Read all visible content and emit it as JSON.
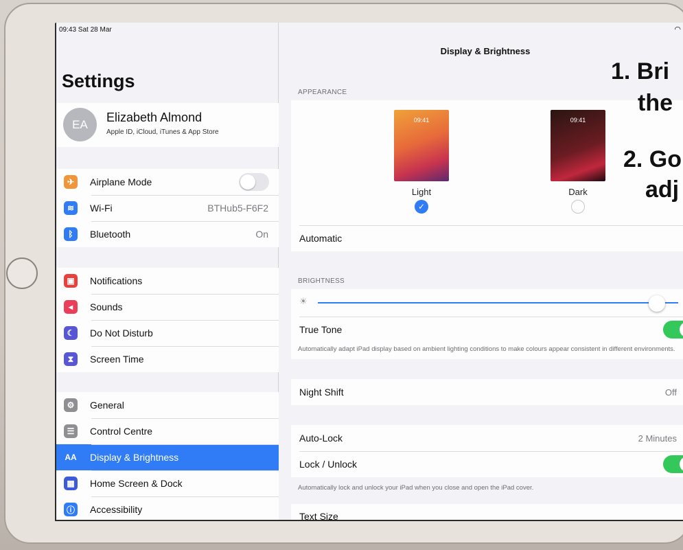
{
  "status": {
    "time": "09:43  Sat 28 Mar",
    "wifi_icon": "wifi-icon"
  },
  "sidebar": {
    "title": "Settings",
    "profile": {
      "initials": "EA",
      "name": "Elizabeth Almond",
      "subtitle": "Apple ID, iCloud, iTunes & App Store"
    },
    "group1": [
      {
        "label": "Airplane Mode",
        "icon": "airplane-icon",
        "color": "#f0953a",
        "glyph": "✈",
        "accessory": "toggle-off"
      },
      {
        "label": "Wi-Fi",
        "icon": "wifi-icon",
        "color": "#2f7cf6",
        "glyph": "≋",
        "value": "BTHub5-F6F2"
      },
      {
        "label": "Bluetooth",
        "icon": "bluetooth-icon",
        "color": "#2f7cf6",
        "glyph": "ᛒ",
        "value": "On"
      }
    ],
    "group2": [
      {
        "label": "Notifications",
        "icon": "notifications-icon",
        "color": "#ea3f3a",
        "glyph": "▣"
      },
      {
        "label": "Sounds",
        "icon": "speaker-icon",
        "color": "#ea3f5a",
        "glyph": "◂"
      },
      {
        "label": "Do Not Disturb",
        "icon": "moon-icon",
        "color": "#5856d6",
        "glyph": "☾"
      },
      {
        "label": "Screen Time",
        "icon": "hourglass-icon",
        "color": "#5856d6",
        "glyph": "⧗"
      }
    ],
    "group3": [
      {
        "label": "General",
        "icon": "gear-icon",
        "color": "#8e8e93",
        "glyph": "⚙"
      },
      {
        "label": "Control Centre",
        "icon": "switches-icon",
        "color": "#8e8e93",
        "glyph": "☰"
      },
      {
        "label": "Display & Brightness",
        "icon": "text-size-icon",
        "color": "#2f7cf6",
        "glyph": "AA",
        "selected": true
      },
      {
        "label": "Home Screen & Dock",
        "icon": "grid-icon",
        "color": "#3d5bd9",
        "glyph": "▦"
      },
      {
        "label": "Accessibility",
        "icon": "accessibility-icon",
        "color": "#2f7cf6",
        "glyph": "ⓘ"
      }
    ]
  },
  "detail": {
    "nav_title": "Display & Brightness",
    "appearance_header": "APPEARANCE",
    "light": {
      "time": "09:41",
      "label": "Light",
      "selected": true
    },
    "dark": {
      "time": "09:41",
      "label": "Dark",
      "selected": false
    },
    "automatic_label": "Automatic",
    "brightness_header": "BRIGHTNESS",
    "brightness_level": 0.94,
    "true_tone_label": "True Tone",
    "true_tone_note": "Automatically adapt iPad display based on ambient lighting conditions to make colours appear consistent in different environments.",
    "night_shift_label": "Night Shift",
    "night_shift_value": "Off",
    "auto_lock_label": "Auto-Lock",
    "auto_lock_value": "2 Minutes",
    "lock_unlock_label": "Lock / Unlock",
    "lock_note": "Automatically lock and unlock your iPad when you close and open the iPad cover.",
    "text_size_label": "Text Size"
  },
  "overlay": {
    "line1": "1. Bri",
    "line2": "the",
    "line3": "2. Go",
    "line4": "adj"
  }
}
